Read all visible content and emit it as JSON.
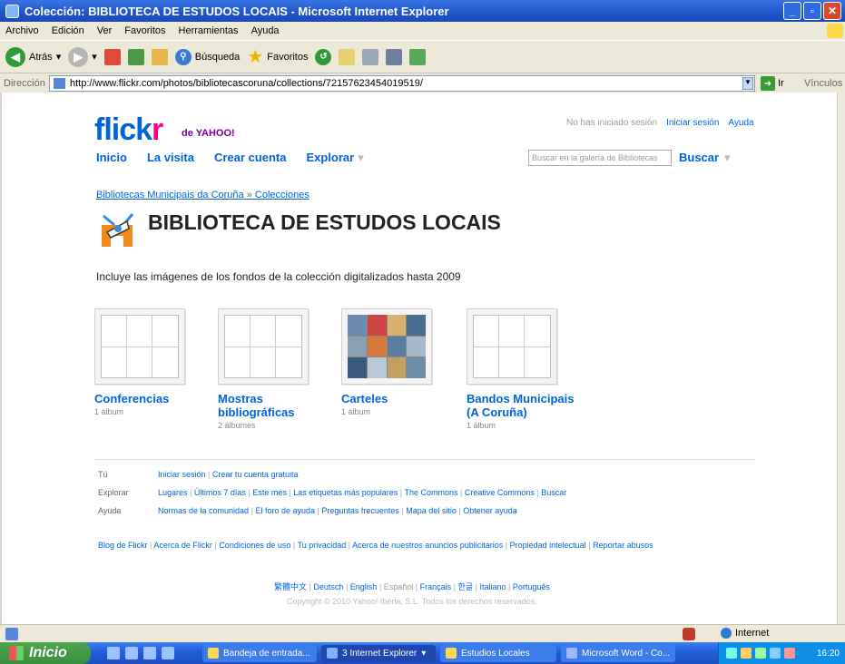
{
  "window": {
    "title": "Colección: BIBLIOTECA DE ESTUDOS LOCAIS - Microsoft Internet Explorer"
  },
  "menu": [
    "Archivo",
    "Edición",
    "Ver",
    "Favoritos",
    "Herramientas",
    "Ayuda"
  ],
  "toolbar": {
    "back": "Atrás",
    "search": "Búsqueda",
    "favorites": "Favoritos"
  },
  "address": {
    "label": "Dirección",
    "url": "http://www.flickr.com/photos/bibliotecascoruna/collections/72157623454019519/",
    "go": "Ir",
    "links": "Vínculos"
  },
  "flickr": {
    "logo_main": "flick",
    "logo_r": "r",
    "logo_sub": "de YAHOO!",
    "nav": [
      "Inicio",
      "La visita",
      "Crear cuenta",
      "Explorar"
    ],
    "not_logged": "No has iniciado sesión",
    "login": "Iniciar sesión",
    "help": "Ayuda",
    "search_placeholder": "Buscar en la galería de Bibliotecas",
    "search_button": "Buscar"
  },
  "breadcrumb": {
    "owner": "Bibliotecas Municipais da Coruña",
    "sep": "»",
    "section": "Colecciones"
  },
  "collection": {
    "title": "BIBLIOTECA DE ESTUDOS LOCAIS",
    "description": "Incluye las imágenes de los fondos de la colección digitalizados hasta 2009"
  },
  "sets": [
    {
      "name": "Conferencias",
      "count": "1 álbum"
    },
    {
      "name": "Mostras bibliográficas",
      "count": "2 álbumes"
    },
    {
      "name": "Carteles",
      "count": "1 álbum"
    },
    {
      "name": "Bandos Municipais (A Coruña)",
      "count": "1 álbum"
    }
  ],
  "footer": {
    "rows": [
      {
        "label": "Tú",
        "items": [
          "Iniciar sesión",
          "Crear tu cuenta gratuita"
        ]
      },
      {
        "label": "Explorar",
        "items": [
          "Lugares",
          "Últimos 7 días",
          "Este mes",
          "Las etiquetas más populares",
          "The Commons",
          "Creative Commons",
          "Buscar"
        ]
      },
      {
        "label": "Ayuda",
        "items": [
          "Normas de la comunidad",
          "El foro de ayuda",
          "Preguntas frecuentes",
          "Mapa del sitio",
          "Obtener ayuda"
        ]
      }
    ],
    "links": [
      "Blog de Flickr",
      "Acerca de Flickr",
      "Condiciones de uso",
      "Tu privacidad",
      "Acerca de nuestros anuncios publicitarios",
      "Propiedad intelectual",
      "Reportar abusos"
    ],
    "languages": [
      "繁體中文",
      "Deutsch",
      "English",
      "Español",
      "Français",
      "한글",
      "Italiano",
      "Português"
    ],
    "copyright": "Copyright © 2010 Yahoo! Ibéria, S.L. Todos los derechos reservados."
  },
  "status": {
    "zone": "Internet"
  },
  "taskbar": {
    "start": "Inicio",
    "tasks": [
      "Bandeja de entrada...",
      "3 Internet Explorer",
      "Estudios Locales",
      "Microsoft Word - Co..."
    ],
    "clock": "16:20"
  },
  "colors": {
    "flickr_blue": "#0063dc",
    "flickr_pink": "#ff0084",
    "xp_blue": "#245edb"
  }
}
